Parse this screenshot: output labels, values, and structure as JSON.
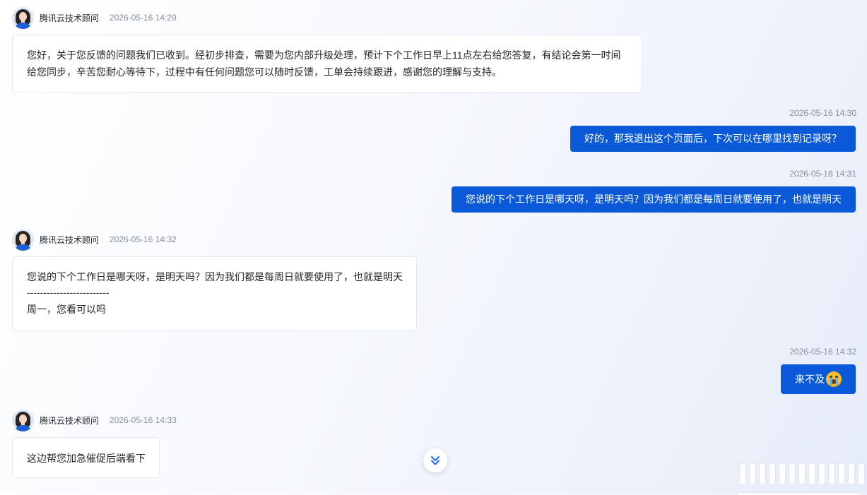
{
  "agent": {
    "name": "腾讯云技术顾问"
  },
  "messages": {
    "m1": {
      "time": "2026-05-16 14:29",
      "lines": [
        "您好，关于您反馈的问题我们已收到。经初步排查，需要为您内部升级处理，预计下个工作日早上11点左右给您答复，有结论会第一时间",
        "给您同步，辛苦您耐心等待下，过程中有任何问题您可以随时反馈，工单会持续跟进，感谢您的理解与支持。"
      ]
    },
    "m2": {
      "time": "2026-05-16 14:30",
      "text": "好的，那我退出这个页面后，下次可以在哪里找到记录呀？"
    },
    "m3": {
      "time": "2026-05-16 14:31",
      "text": "您说的下个工作日是哪天呀，是明天吗？因为我们都是每周日就要使用了，也就是明天"
    },
    "m4": {
      "time": "2026-05-16 14:32",
      "lines": [
        "您说的下个工作日是哪天呀，是明天吗？因为我们都是每周日就要使用了，也就是明天",
        "-------------------------",
        "周一，您看可以吗"
      ]
    },
    "m5": {
      "time": "2026-05-16 14:32",
      "text": "来不及",
      "emoji": "crying-face-emoji"
    },
    "m6": {
      "time": "2026-05-16 14:33",
      "text": "这边帮您加急催促后端看下"
    }
  },
  "icons": {
    "scroll_down": "double-chevron-down-icon"
  },
  "colors": {
    "outgoing_bubble": "#0a59d8",
    "accent": "#1b6ef3",
    "timestamp": "#8a919f"
  }
}
